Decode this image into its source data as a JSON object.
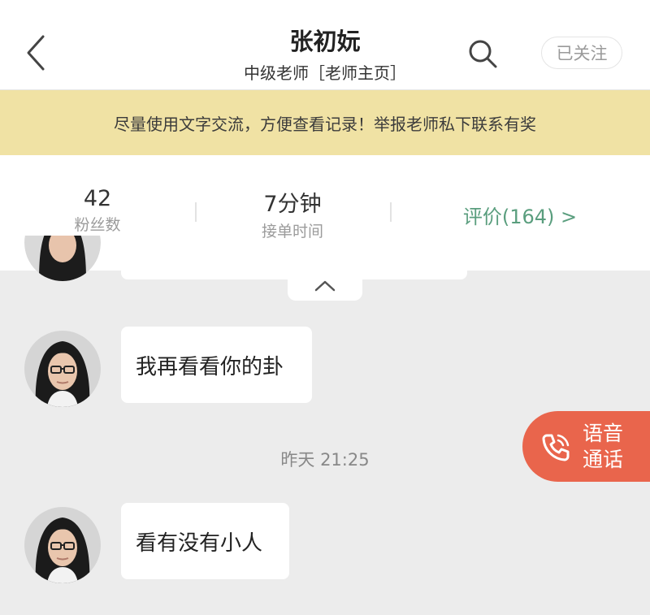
{
  "header": {
    "title": "张初妧",
    "subtitle": "中级老师［老师主页］",
    "follow_label": "已关注"
  },
  "notice": {
    "text": "尽量使用文字交流，方便查看记录！举报老师私下联系有奖"
  },
  "stats": {
    "fans_value": "42",
    "fans_label": "粉丝数",
    "time_value": "7分钟",
    "time_label": "接单时间",
    "reviews_label": "评价(164) >"
  },
  "chat": {
    "messages": [
      {
        "sender": "teacher",
        "text": "我再看看你的卦"
      },
      {
        "sender": "teacher",
        "text": "看有没有小人"
      }
    ],
    "timestamp": "昨天 21:25"
  },
  "voice_call": {
    "line1": "语音",
    "line2": "通话"
  },
  "colors": {
    "notice_bg": "#f0e2a4",
    "reviews_text": "#5a9e7e",
    "voice_call_bg": "#e9654c",
    "chat_bg": "#ececec"
  },
  "icons": {
    "back": "chevron-left-icon",
    "search": "search-icon",
    "collapse": "chevron-up-icon",
    "phone": "phone-icon"
  }
}
